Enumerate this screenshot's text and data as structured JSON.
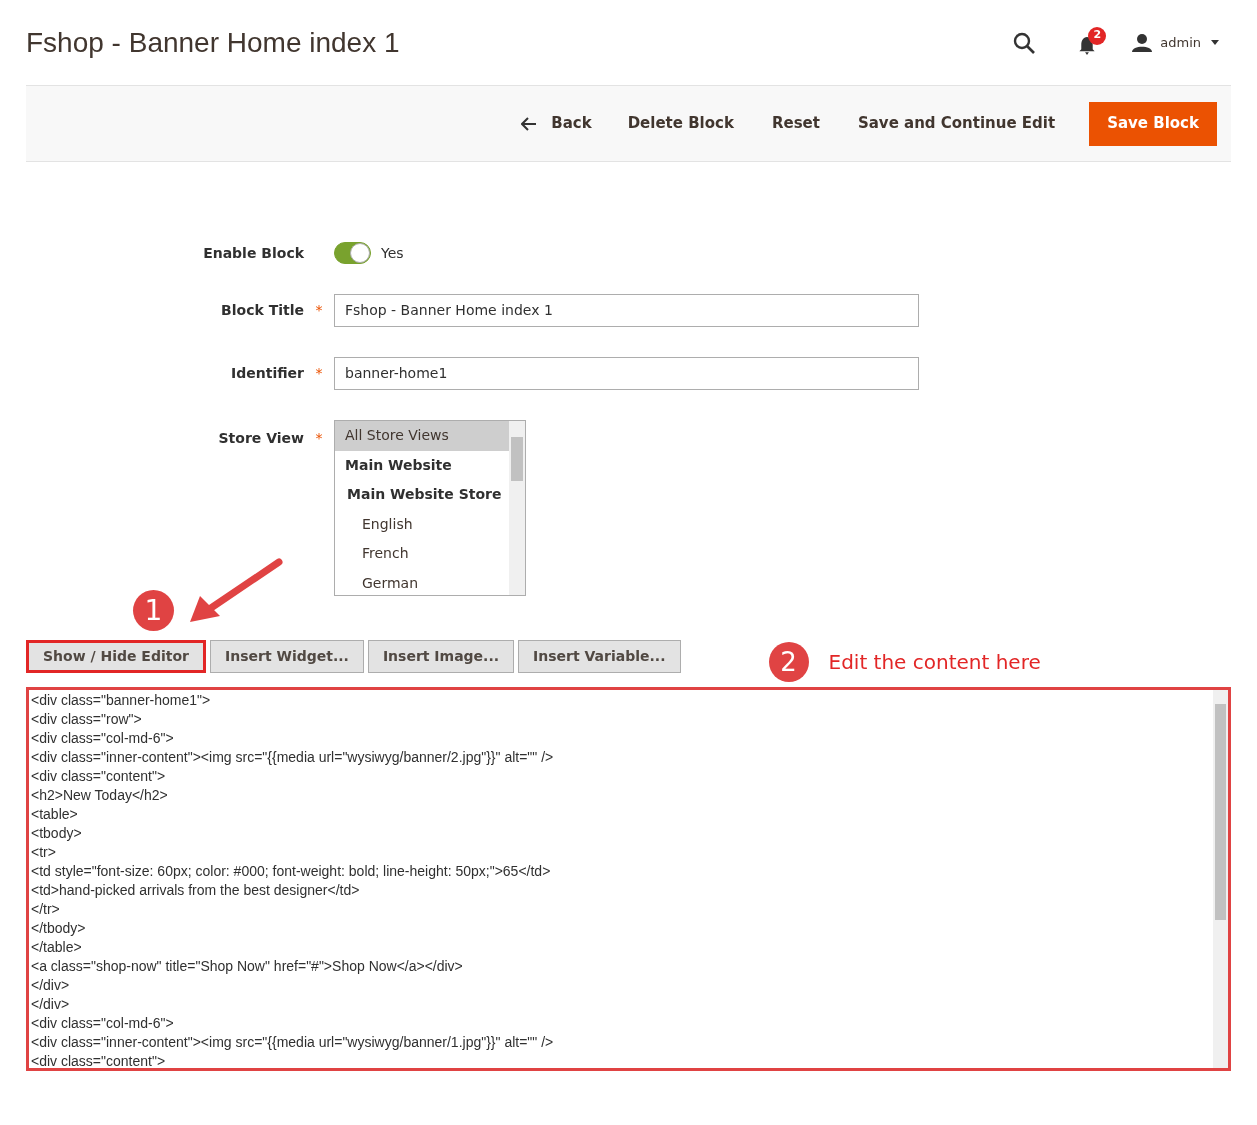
{
  "page_title": "Fshop - Banner Home index 1",
  "header": {
    "notification_count": "2",
    "user": "admin"
  },
  "actions": [
    {
      "label": "Back",
      "kind": "back"
    },
    {
      "label": "Delete Block",
      "kind": "plain"
    },
    {
      "label": "Reset",
      "kind": "plain"
    },
    {
      "label": "Save and Continue Edit",
      "kind": "plain"
    },
    {
      "label": "Save Block",
      "kind": "primary"
    }
  ],
  "form": {
    "enable_block": {
      "label": "Enable Block",
      "on": true,
      "value_text": "Yes"
    },
    "block_title": {
      "label": "Block Title",
      "required_mark": "*",
      "value": "Fshop - Banner Home index 1"
    },
    "identifier": {
      "label": "Identifier",
      "required_mark": "*",
      "value": "banner-home1"
    },
    "store_view": {
      "label": "Store View",
      "required_mark": "*",
      "options": [
        {
          "label": "All Store Views",
          "selected": true
        },
        {
          "label": "Main Website",
          "selected": false,
          "children": [
            {
              "label": "Main Website Store",
              "selected": false,
              "children": [
                {
                  "label": "English",
                  "selected": false
                },
                {
                  "label": "French",
                  "selected": false
                },
                {
                  "label": "German",
                  "selected": false
                }
              ]
            }
          ]
        }
      ]
    }
  },
  "editor_buttons": [
    {
      "label": "Show / Hide Editor",
      "highlighted": true
    },
    {
      "label": "Insert Widget...",
      "highlighted": false
    },
    {
      "label": "Insert Image...",
      "highlighted": false
    },
    {
      "label": "Insert Variable...",
      "highlighted": false
    }
  ],
  "annotations": [
    {
      "number": "1"
    },
    {
      "number": "2",
      "text": "Edit the content here"
    }
  ],
  "editor_lines": [
    "<div class=\"banner-home1\">",
    "<div class=\"row\">",
    "<div class=\"col-md-6\">",
    "<div class=\"inner-content\"><img src=\"{{media url=\"wysiwyg/banner/2.jpg\"}}\" alt=\"\" />",
    "<div class=\"content\">",
    "<h2>New Today</h2>",
    "<table>",
    "<tbody>",
    "<tr>",
    "<td style=\"font-size: 60px; color: #000; font-weight: bold; line-height: 50px;\">65</td>",
    "<td>hand-picked arrivals from the best designer</td>",
    "</tr>",
    "</tbody>",
    "</table>",
    "<a class=\"shop-now\" title=\"Shop Now\" href=\"#\">Shop Now</a></div>",
    "</div>",
    "</div>",
    "<div class=\"col-md-6\">",
    "<div class=\"inner-content\"><img src=\"{{media url=\"wysiwyg/banner/1.jpg\"}}\" alt=\"\" />",
    "<div class=\"content\">"
  ]
}
